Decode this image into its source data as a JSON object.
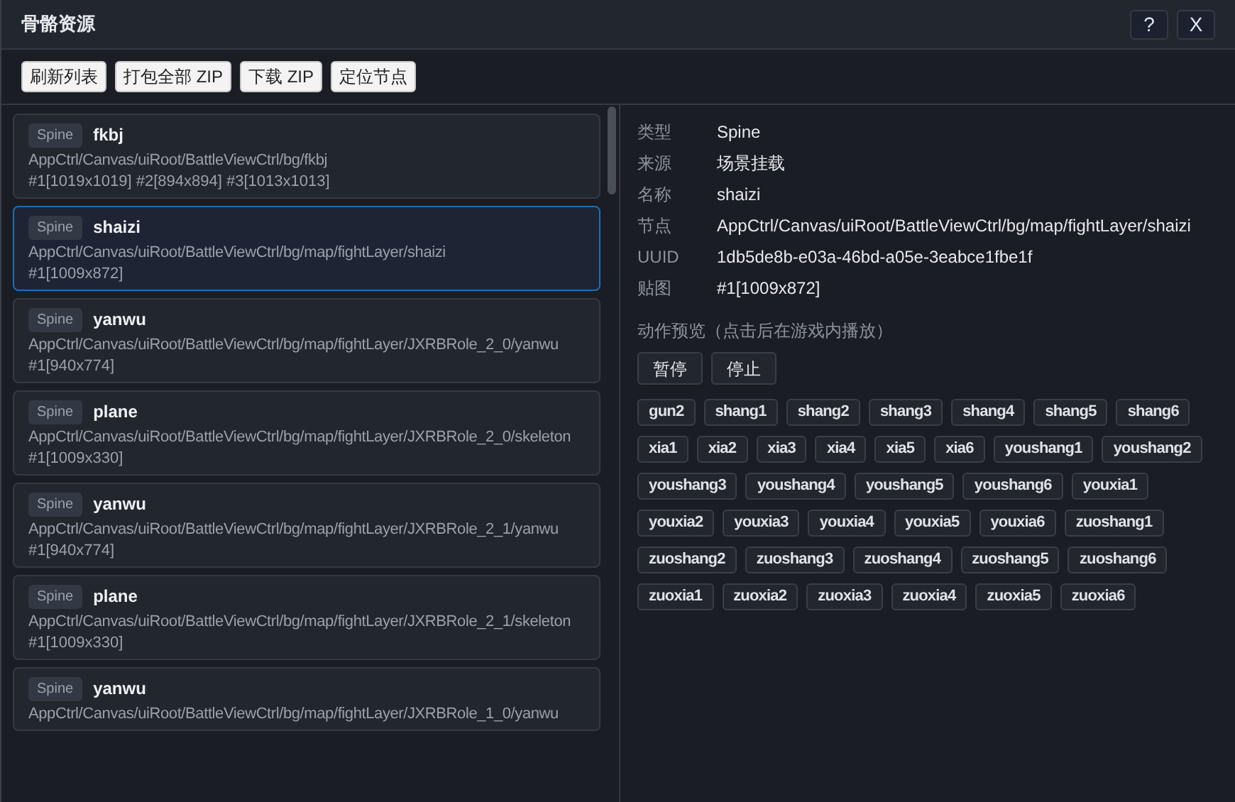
{
  "window": {
    "title": "骨骼资源",
    "buttons": [
      "?",
      "X"
    ]
  },
  "toolbar": [
    "刷新列表",
    "打包全部 ZIP",
    "下载 ZIP",
    "定位节点"
  ],
  "list": [
    {
      "type": "Spine",
      "name": "fkbj",
      "path": "AppCtrl/Canvas/uiRoot/BattleViewCtrl/bg/fkbj",
      "textures": "#1[1019x1019] #2[894x894] #3[1013x1013]",
      "selected": false
    },
    {
      "type": "Spine",
      "name": "shaizi",
      "path": "AppCtrl/Canvas/uiRoot/BattleViewCtrl/bg/map/fightLayer/shaizi",
      "textures": "#1[1009x872]",
      "selected": true
    },
    {
      "type": "Spine",
      "name": "yanwu",
      "path": "AppCtrl/Canvas/uiRoot/BattleViewCtrl/bg/map/fightLayer/JXRBRole_2_0/yanwu",
      "textures": "#1[940x774]",
      "selected": false
    },
    {
      "type": "Spine",
      "name": "plane",
      "path": "AppCtrl/Canvas/uiRoot/BattleViewCtrl/bg/map/fightLayer/JXRBRole_2_0/skeleton",
      "textures": "#1[1009x330]",
      "selected": false
    },
    {
      "type": "Spine",
      "name": "yanwu",
      "path": "AppCtrl/Canvas/uiRoot/BattleViewCtrl/bg/map/fightLayer/JXRBRole_2_1/yanwu",
      "textures": "#1[940x774]",
      "selected": false
    },
    {
      "type": "Spine",
      "name": "plane",
      "path": "AppCtrl/Canvas/uiRoot/BattleViewCtrl/bg/map/fightLayer/JXRBRole_2_1/skeleton",
      "textures": "#1[1009x330]",
      "selected": false
    },
    {
      "type": "Spine",
      "name": "yanwu",
      "path": "AppCtrl/Canvas/uiRoot/BattleViewCtrl/bg/map/fightLayer/JXRBRole_1_0/yanwu",
      "selected": false
    }
  ],
  "details": [
    {
      "label": "类型",
      "value": "Spine"
    },
    {
      "label": "来源",
      "value": "场景挂载"
    },
    {
      "label": "名称",
      "value": "shaizi"
    },
    {
      "label": "节点",
      "value": "AppCtrl/Canvas/uiRoot/BattleViewCtrl/bg/map/fightLayer/shaizi"
    },
    {
      "label": "UUID",
      "value": "1db5de8b-e03a-46bd-a05e-3eabce1fbe1f"
    },
    {
      "label": "贴图",
      "value": "#1[1009x872]"
    }
  ],
  "preview": {
    "title": "动作预览（点击后在游戏内播放）",
    "controls": [
      "暂停",
      "停止"
    ],
    "animations": [
      "gun2",
      "shang1",
      "shang2",
      "shang3",
      "shang4",
      "shang5",
      "shang6",
      "xia1",
      "xia2",
      "xia3",
      "xia4",
      "xia5",
      "xia6",
      "youshang1",
      "youshang2",
      "youshang3",
      "youshang4",
      "youshang5",
      "youshang6",
      "youxia1",
      "youxia2",
      "youxia3",
      "youxia4",
      "youxia5",
      "youxia6",
      "zuoshang1",
      "zuoshang2",
      "zuoshang3",
      "zuoshang4",
      "zuoshang5",
      "zuoshang6",
      "zuoxia1",
      "zuoxia2",
      "zuoxia3",
      "zuoxia4",
      "zuoxia5",
      "zuoxia6"
    ]
  }
}
